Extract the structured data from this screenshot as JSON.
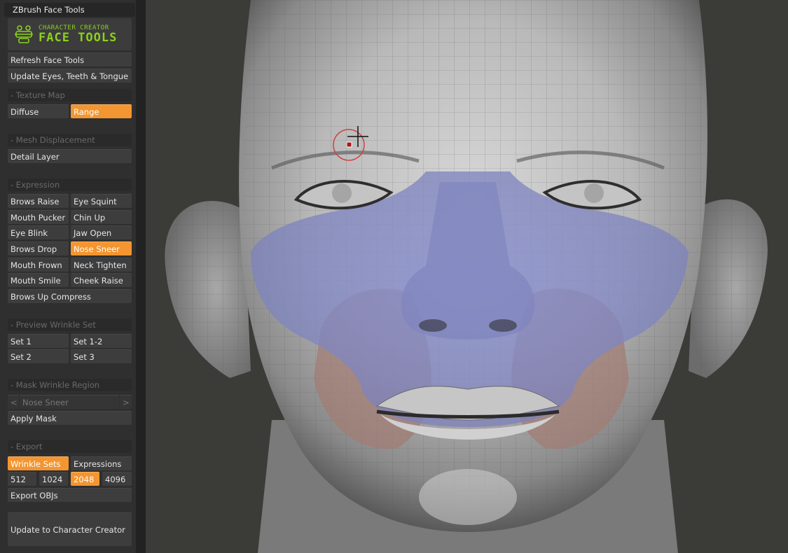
{
  "panel": {
    "title": "ZBrush Face Tools",
    "logo": {
      "subtitle": "CHARACTER CREATOR",
      "title": "FACE TOOLS",
      "icon": "face-tools-logo-icon",
      "color": "#8bd11a"
    },
    "refresh": "Refresh Face Tools",
    "update_eyes": "Update Eyes, Teeth & Tongue",
    "texture_map": {
      "header": "- Texture Map",
      "diffuse": "Diffuse",
      "range": "Range"
    },
    "mesh_displacement": {
      "header": "- Mesh Displacement",
      "detail_layer": "Detail Layer"
    },
    "expression": {
      "header": "- Expression",
      "items": [
        "Brows Raise",
        "Eye Squint",
        "Mouth Pucker",
        "Chin Up",
        "Eye Blink",
        "Jaw Open",
        "Brows Drop",
        "Nose Sneer",
        "Mouth Frown",
        "Neck Tighten",
        "Mouth Smile",
        "Cheek Raise",
        "Brows Up Compress"
      ],
      "active": "Nose Sneer"
    },
    "preview_wrinkle_set": {
      "header": "- Preview Wrinkle Set",
      "items": [
        "Set 1",
        "Set 1-2",
        "Set 2",
        "Set 3"
      ]
    },
    "mask_wrinkle_region": {
      "header": "- Mask Wrinkle Region",
      "prev": "<",
      "value": "Nose Sneer",
      "next": ">",
      "apply": "Apply Mask"
    },
    "export": {
      "header": "- Export",
      "wrinkle_sets": "Wrinkle Sets",
      "expressions": "Expressions",
      "sizes": [
        "512",
        "1024",
        "2048",
        "4096"
      ],
      "active_size": "2048",
      "export_objs": "Export OBJs"
    },
    "update_cc": "Update to Character Creator"
  },
  "colors": {
    "accent": "#f39530",
    "panel": "#2f2f2f",
    "viewport": "#3b3b38",
    "mask_blue": "#8c93d0",
    "mask_red": "#a37a72"
  }
}
